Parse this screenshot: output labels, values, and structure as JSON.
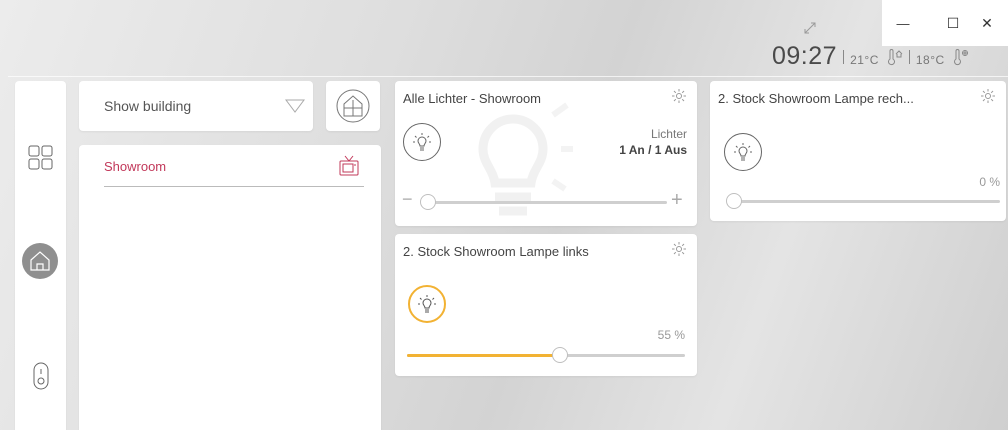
{
  "window": {
    "minimize": "—",
    "maximize": "☐",
    "close": "✕"
  },
  "header": {
    "time": "09:27",
    "indoor_temp": "21°C",
    "outdoor_temp": "18°C"
  },
  "sidebar": {
    "items": [
      {
        "icon": "grid-icon"
      },
      {
        "icon": "home-icon",
        "active": true
      },
      {
        "icon": "switch-icon"
      }
    ]
  },
  "building_select": {
    "value": "Show building"
  },
  "rooms": [
    {
      "label": "Showroom",
      "icon": "tv-icon"
    }
  ],
  "cards": {
    "all_lights": {
      "title": "Alle Lichter - Showroom",
      "label": "Lichter",
      "status": "1 An / 1 Aus",
      "minus": "−",
      "plus": "+"
    },
    "lamp_right": {
      "title": "2. Stock Showroom Lampe rech...",
      "percent_text": "0 %",
      "level": 0
    },
    "lamp_left": {
      "title": "2. Stock Showroom Lampe links",
      "percent_text": "55 %",
      "level": 55
    }
  },
  "colors": {
    "accent": "#f2b233",
    "room_active": "#c2385a",
    "home_active": "#8f8f8f"
  }
}
